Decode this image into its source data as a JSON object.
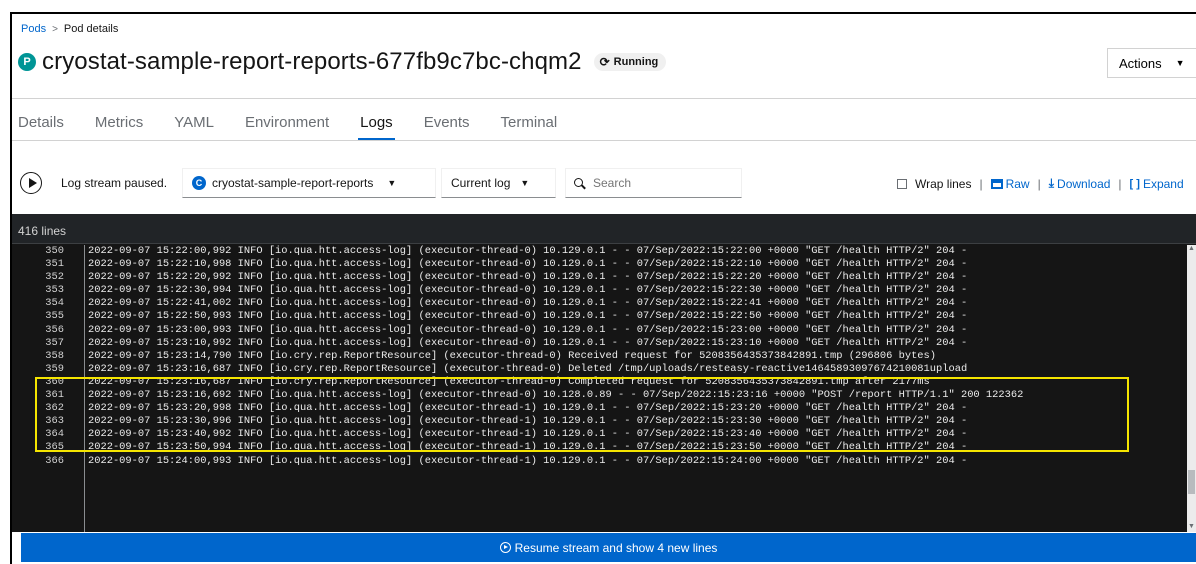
{
  "breadcrumb": {
    "pods_link": "Pods",
    "separator": ">",
    "current": "Pod details"
  },
  "header": {
    "badge": "P",
    "title": "cryostat-sample-report-reports-677fb9c7bc-chqm2",
    "status_icon": "sync-icon",
    "status": "Running",
    "actions_label": "Actions"
  },
  "tabs": [
    {
      "label": "Details"
    },
    {
      "label": "Metrics"
    },
    {
      "label": "YAML"
    },
    {
      "label": "Environment"
    },
    {
      "label": "Logs",
      "active": true
    },
    {
      "label": "Events"
    },
    {
      "label": "Terminal"
    }
  ],
  "toolbar": {
    "stream_status": "Log stream paused.",
    "container_badge": "C",
    "container": "cryostat-sample-report-reports",
    "log_type": "Current log",
    "search_placeholder": "Search",
    "wrap_lines": "Wrap lines",
    "raw": "Raw",
    "download": "Download",
    "expand": "Expand"
  },
  "log": {
    "line_count": "416 lines",
    "lines": [
      {
        "n": "350",
        "text": "2022-09-07 15:22:00,992 INFO [io.qua.htt.access-log] (executor-thread-0) 10.129.0.1 - - 07/Sep/2022:15:22:00 +0000 \"GET /health HTTP/2\" 204 -"
      },
      {
        "n": "351",
        "text": "2022-09-07 15:22:10,998 INFO [io.qua.htt.access-log] (executor-thread-0) 10.129.0.1 - - 07/Sep/2022:15:22:10 +0000 \"GET /health HTTP/2\" 204 -"
      },
      {
        "n": "352",
        "text": "2022-09-07 15:22:20,992 INFO [io.qua.htt.access-log] (executor-thread-0) 10.129.0.1 - - 07/Sep/2022:15:22:20 +0000 \"GET /health HTTP/2\" 204 -"
      },
      {
        "n": "353",
        "text": "2022-09-07 15:22:30,994 INFO [io.qua.htt.access-log] (executor-thread-0) 10.129.0.1 - - 07/Sep/2022:15:22:30 +0000 \"GET /health HTTP/2\" 204 -"
      },
      {
        "n": "354",
        "text": "2022-09-07 15:22:41,002 INFO [io.qua.htt.access-log] (executor-thread-0) 10.129.0.1 - - 07/Sep/2022:15:22:41 +0000 \"GET /health HTTP/2\" 204 -"
      },
      {
        "n": "355",
        "text": "2022-09-07 15:22:50,993 INFO [io.qua.htt.access-log] (executor-thread-0) 10.129.0.1 - - 07/Sep/2022:15:22:50 +0000 \"GET /health HTTP/2\" 204 -"
      },
      {
        "n": "356",
        "text": "2022-09-07 15:23:00,993 INFO [io.qua.htt.access-log] (executor-thread-0) 10.129.0.1 - - 07/Sep/2022:15:23:00 +0000 \"GET /health HTTP/2\" 204 -"
      },
      {
        "n": "357",
        "text": "2022-09-07 15:23:10,992 INFO [io.qua.htt.access-log] (executor-thread-0) 10.129.0.1 - - 07/Sep/2022:15:23:10 +0000 \"GET /health HTTP/2\" 204 -"
      },
      {
        "n": "358",
        "text": "2022-09-07 15:23:14,790 INFO [io.cry.rep.ReportResource] (executor-thread-0) Received request for 5208356435373842891.tmp (296806 bytes)"
      },
      {
        "n": "359",
        "text": "2022-09-07 15:23:16,687 INFO [io.cry.rep.ReportResource] (executor-thread-0) Deleted /tmp/uploads/resteasy-reactive14645893097674210081upload"
      },
      {
        "n": "360",
        "text": "2022-09-07 15:23:16,687 INFO [io.cry.rep.ReportResource] (executor-thread-0) Completed request for 5208356435373842891.tmp after 2177ms"
      },
      {
        "n": "361",
        "text": "2022-09-07 15:23:16,692 INFO [io.qua.htt.access-log] (executor-thread-0) 10.128.0.89 - - 07/Sep/2022:15:23:16 +0000 \"POST /report HTTP/1.1\" 200 122362"
      },
      {
        "n": "362",
        "text": "2022-09-07 15:23:20,998 INFO [io.qua.htt.access-log] (executor-thread-1) 10.129.0.1 - - 07/Sep/2022:15:23:20 +0000 \"GET /health HTTP/2\" 204 -"
      },
      {
        "n": "363",
        "text": "2022-09-07 15:23:30,996 INFO [io.qua.htt.access-log] (executor-thread-1) 10.129.0.1 - - 07/Sep/2022:15:23:30 +0000 \"GET /health HTTP/2\" 204 -"
      },
      {
        "n": "364",
        "text": "2022-09-07 15:23:40,992 INFO [io.qua.htt.access-log] (executor-thread-1) 10.129.0.1 - - 07/Sep/2022:15:23:40 +0000 \"GET /health HTTP/2\" 204 -"
      },
      {
        "n": "365",
        "text": "2022-09-07 15:23:50,994 INFO [io.qua.htt.access-log] (executor-thread-1) 10.129.0.1 - - 07/Sep/2022:15:23:50 +0000 \"GET /health HTTP/2\" 204 -"
      },
      {
        "n": "366",
        "text": "2022-09-07 15:24:00,993 INFO [io.qua.htt.access-log] (executor-thread-1) 10.129.0.1 - - 07/Sep/2022:15:24:00 +0000 \"GET /health HTTP/2\" 204 -"
      }
    ]
  },
  "resume_button": "Resume stream and show 4 new lines",
  "colors": {
    "accent": "#0066cc",
    "highlight": "#f5e500",
    "log_bg": "#151515",
    "pod_badge": "#009596"
  }
}
